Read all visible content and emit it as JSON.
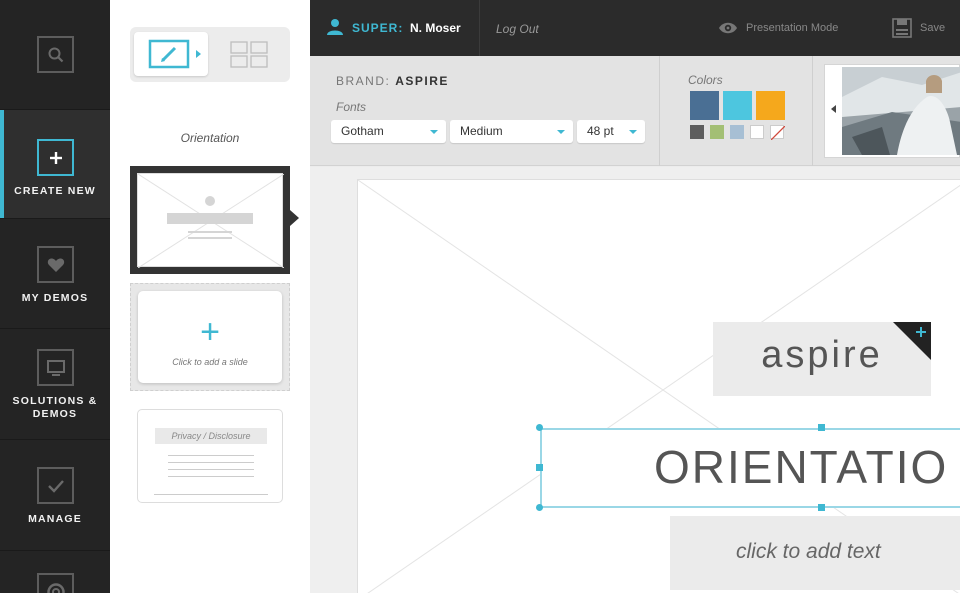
{
  "sidebar": {
    "items": [
      {
        "label": "",
        "icon": "search-icon"
      },
      {
        "label": "CREATE NEW",
        "icon": "plus-square-icon",
        "active": true
      },
      {
        "label": "MY DEMOS",
        "icon": "heart-icon"
      },
      {
        "label": "SOLUTIONS & DEMOS",
        "icon": "monitor-icon"
      },
      {
        "label": "MANAGE",
        "icon": "checkmark-icon"
      },
      {
        "label": "",
        "icon": "lifebuoy-icon"
      }
    ]
  },
  "slides_panel": {
    "section_label": "Orientation",
    "add_slide_label": "Click to add a slide",
    "disclosure_label": "Privacy / Disclosure",
    "view_toggle": {
      "active": "edit",
      "options": [
        "edit-view-icon",
        "grid-view-icon"
      ]
    }
  },
  "topbar": {
    "role_label": "SUPER:",
    "user_name": "N. Moser",
    "logout_label": "Log Out",
    "presentation_label": "Presentation Mode",
    "save_label": "Save"
  },
  "brand_bar": {
    "brand_prefix": "BRAND:",
    "brand_name": "ASPIRE",
    "fonts_label": "Fonts",
    "font_family": "Gotham",
    "font_weight": "Medium",
    "font_size": "48 pt",
    "colors_label": "Colors",
    "primary_colors": [
      "#4a6f94",
      "#4dc6df",
      "#f5a81c"
    ],
    "secondary_colors": [
      "#5e5e5e",
      "#a3bf74",
      "#a7bfd4",
      "#ffffff",
      "none"
    ]
  },
  "canvas": {
    "logo_text": "aspire",
    "title_text": "ORIENTATIO",
    "subtitle_placeholder": "click to add text"
  },
  "colors": {
    "accent": "#3fb8d2",
    "nav_bg": "#242424",
    "topbar_bg": "#2b2b2b"
  }
}
